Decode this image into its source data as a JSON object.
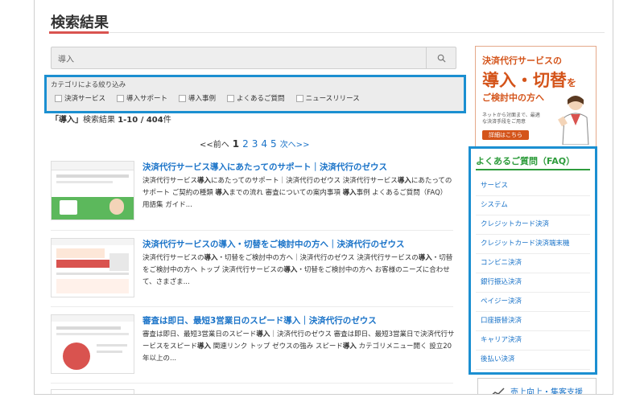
{
  "page": {
    "title": "検索結果"
  },
  "search": {
    "value": "導入"
  },
  "filter": {
    "heading": "カテゴリによる絞り込み",
    "options": [
      "決済サービス",
      "導入サポート",
      "導入事例",
      "よくあるご質問",
      "ニュースリリース"
    ]
  },
  "result_count": {
    "query": "「導入」",
    "label": "検索結果",
    "range": "1-10 / 404",
    "suffix": "件"
  },
  "pagination": {
    "prev": "<<前へ",
    "current": "1",
    "pages": [
      "2",
      "3",
      "4",
      "5"
    ],
    "next": "次へ>>"
  },
  "results": [
    {
      "title": "決済代行サービス導入にあたってのサポート｜決済代行のゼウス",
      "snippet_html": "決済代行サービス<b>導入</b>にあたってのサポート｜決済代行のゼウス 決済代行サービス<b>導入</b>にあたってのサポート ご契約の種類 <b>導入</b>までの流れ 審査についての案内事項 <b>導入</b>事例 よくあるご質問（FAQ） 用語集 ガイド..."
    },
    {
      "title": "決済代行サービスの導入・切替をご検討中の方へ｜決済代行のゼウス",
      "snippet_html": "決済代行サービスの<b>導入</b>・切替をご検討中の方へ｜決済代行のゼウス 決済代行サービスの<b>導入</b>・切替をご検討中の方へ トップ 決済代行サービスの<b>導入</b>・切替をご検討中の方へ お客様のニーズに合わせて、さまざま..."
    },
    {
      "title": "審査は即日、最短3営業日のスピード導入｜決済代行のゼウス",
      "snippet_html": "審査は即日、最短3営業日のスピード<b>導入</b>｜決済代行のゼウス 審査は即日、最短3営業日で決済代行サービスをスピード<b>導入</b> 関連リンク トップ ゼウスの強み スピード<b>導入</b> カテゴリメニュー開く 設立20年以上の..."
    }
  ],
  "banner": {
    "line1": "決済代行サービスの",
    "line2": "導入・切替",
    "line2_suffix": "を",
    "line3": "ご検討中の方へ",
    "line4": "ネットから対面まで、最適な決済手段をご用意",
    "button": "詳細はこちら"
  },
  "faq": {
    "title": "よくあるご質問（FAQ）",
    "items": [
      "サービス",
      "システム",
      "クレジットカード決済",
      "クレジットカード決済端末機",
      "コンビニ決済",
      "銀行振込決済",
      "ペイジー決済",
      "口座振替決済",
      "キャリア決済",
      "後払い決済"
    ]
  },
  "bottom_banner": {
    "label": "売上向上・集客支援"
  },
  "colors": {
    "accent_blue": "#1b8fd1",
    "link": "#1a73c8",
    "faq_green": "#2e9c3c",
    "banner_orange": "#d4541a"
  }
}
